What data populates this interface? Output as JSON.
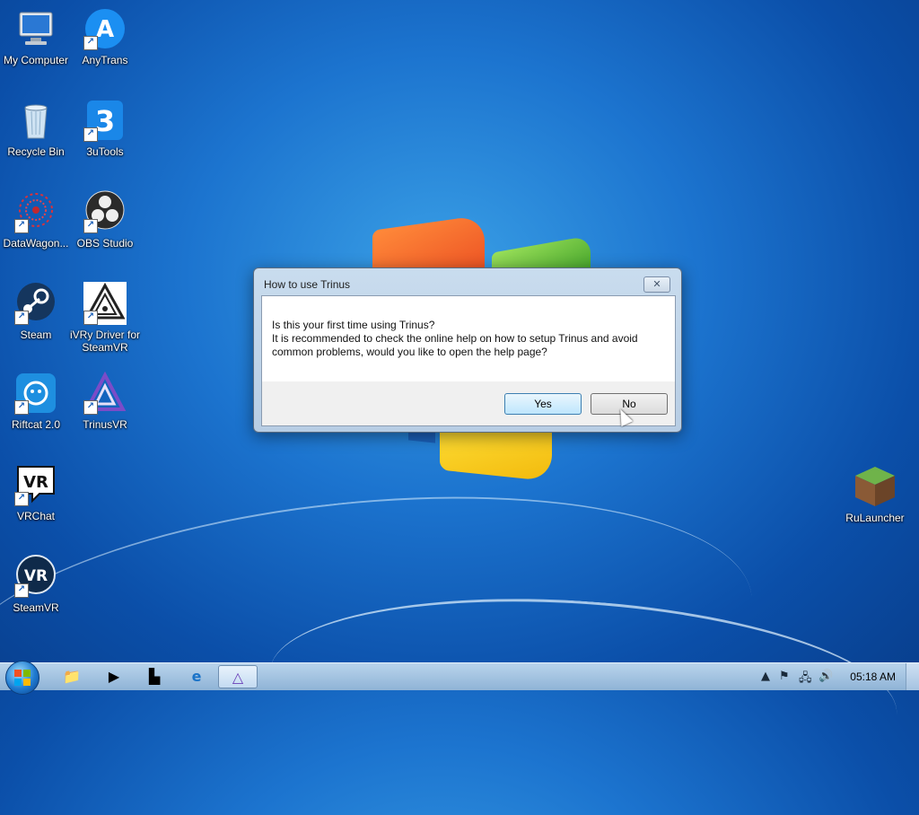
{
  "desktop": {
    "icons": [
      {
        "label": "My Computer",
        "icon": "computer-icon"
      },
      {
        "label": "AnyTrans",
        "icon": "anytrans-icon"
      },
      {
        "label": "Recycle Bin",
        "icon": "recycle-bin-icon"
      },
      {
        "label": "3uTools",
        "icon": "3utools-icon"
      },
      {
        "label": "DataWagon...",
        "icon": "datawagon-icon"
      },
      {
        "label": "OBS Studio",
        "icon": "obs-icon"
      },
      {
        "label": "Steam",
        "icon": "steam-icon"
      },
      {
        "label": "iVRy Driver for SteamVR",
        "icon": "ivry-icon"
      },
      {
        "label": "Riftcat 2.0",
        "icon": "riftcat-icon"
      },
      {
        "label": "TrinusVR",
        "icon": "trinusvr-icon"
      },
      {
        "label": "VRChat",
        "icon": "vrchat-icon"
      },
      {
        "label": "SteamVR",
        "icon": "steamvr-icon"
      },
      {
        "label": "RuLauncher",
        "icon": "minecraft-icon"
      }
    ]
  },
  "dialog": {
    "title": "How to use Trinus",
    "close_label": "✕",
    "message_line1": "Is this your first time using Trinus?",
    "message_line2": "It is recommended to check the online help on how to setup Trinus and avoid",
    "message_line3": "common problems, would you like to open the help page?",
    "yes_label": "Yes",
    "no_label": "No"
  },
  "taskbar": {
    "pinned": [
      "explorer-icon",
      "media-player-icon",
      "app-icon",
      "internet-explorer-icon",
      "trinusvr-icon"
    ],
    "clock": "05:18 AM"
  },
  "colors": {
    "desktop_blue": "#1c74cf",
    "button_default": "#bee6fd",
    "taskbar": "#8fb3d6"
  }
}
